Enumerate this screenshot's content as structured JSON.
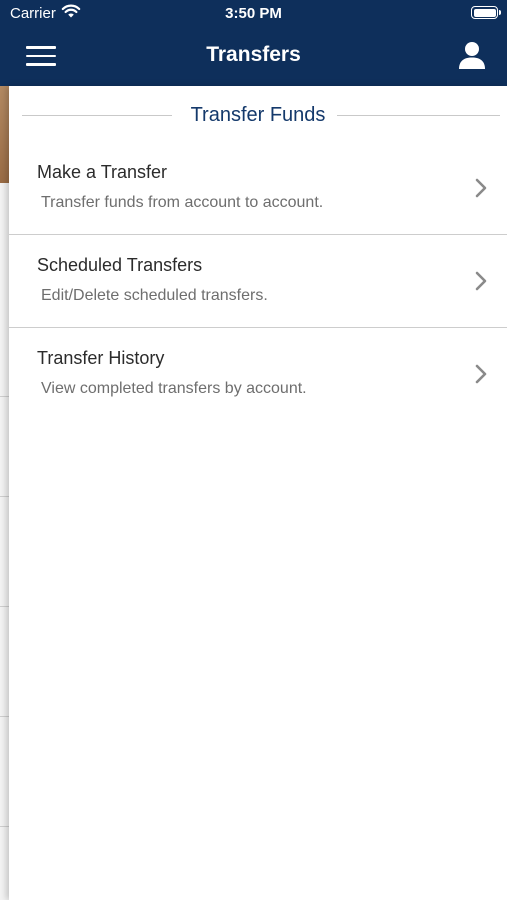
{
  "status_bar": {
    "carrier": "Carrier",
    "time": "3:50 PM"
  },
  "nav": {
    "title": "Transfers",
    "menu_icon": "hamburger-menu-icon",
    "profile_icon": "user-profile-icon"
  },
  "section": {
    "title": "Transfer Funds"
  },
  "items": [
    {
      "title": "Make a Transfer",
      "subtitle": "Transfer funds from account to account."
    },
    {
      "title": "Scheduled Transfers",
      "subtitle": "Edit/Delete scheduled transfers."
    },
    {
      "title": "Transfer History",
      "subtitle": "View completed transfers by account."
    }
  ],
  "colors": {
    "header_bg": "#0e2f5b",
    "section_title": "#14396b",
    "row_title": "#2b2b2b",
    "row_subtitle": "#6e6e6e",
    "chevron": "#8a8a8a"
  }
}
